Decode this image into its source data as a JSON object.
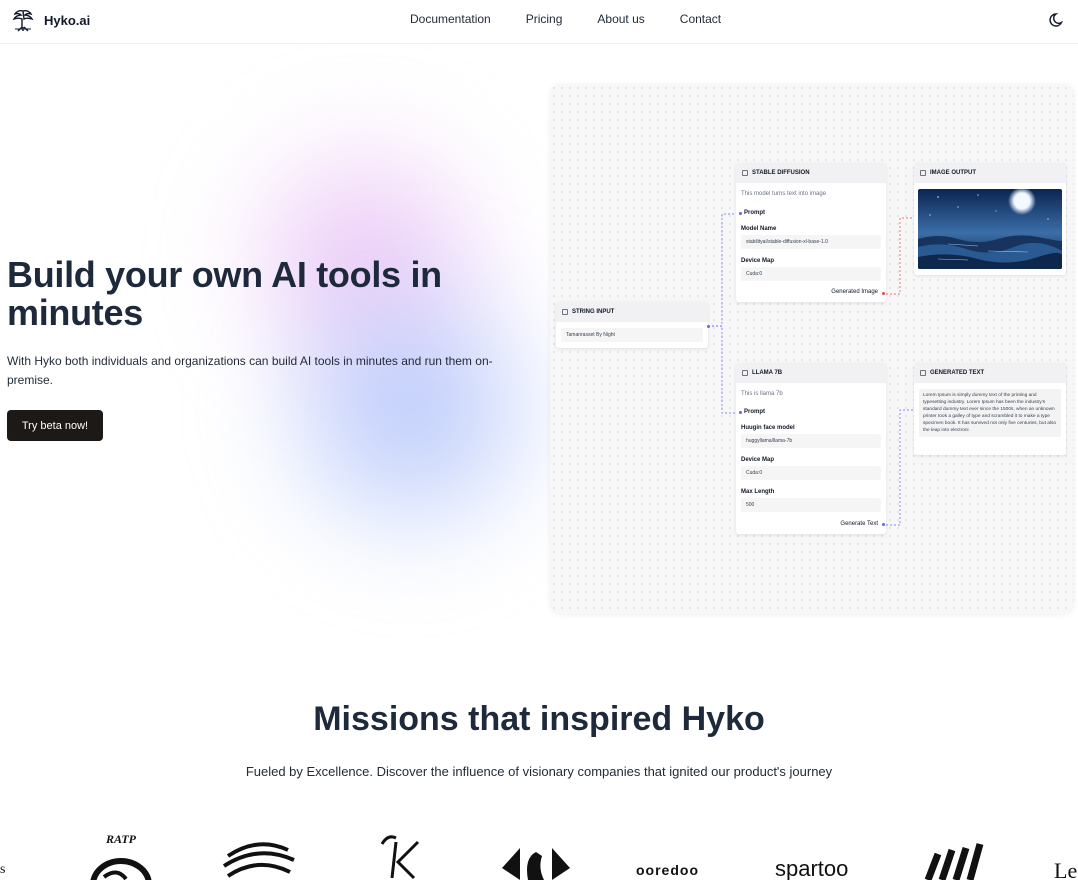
{
  "brand": {
    "name": "Hyko.ai"
  },
  "nav": {
    "links": [
      "Documentation",
      "Pricing",
      "About us",
      "Contact"
    ]
  },
  "hero": {
    "title": "Build your own AI tools in minutes",
    "subtitle": "With Hyko both individuals and organizations can build AI tools in minutes and run them on-premise.",
    "cta": "Try beta now!"
  },
  "canvas": {
    "string_input": {
      "title": "STRING INPUT",
      "value": "Tamanrasset By Night"
    },
    "stable_diffusion": {
      "title": "STABLE DIFFUSION",
      "desc": "This model turns text into image",
      "prompt": "Prompt",
      "model_label": "Model Name",
      "model_value": "stabilityai/stable-diffusion-xl-base-1.0",
      "device_label": "Device Map",
      "device_value": "Cuda:0",
      "output": "Generated Image"
    },
    "image_output": {
      "title": "IMAGE OUTPUT"
    },
    "llama": {
      "title": "LLAMA 7B",
      "desc": "This is llama 7b",
      "prompt": "Prompt",
      "model_label": "Huugin face model",
      "model_value": "huggyllama/llama-7b",
      "device_label": "Device Map",
      "device_value": "Cuda:0",
      "max_label": "Max Length",
      "max_value": "500",
      "output": "Generate Text"
    },
    "generated_text": {
      "title": "GENERATED TEXT",
      "text": "Lorem Ipsum is simply dummy text of the printing and typesetting industry. Lorem Ipsum has been the industry's standard dummy text ever since the 1500s, when an unknown printer took a galley of type and scrambled it to make a type specimen book. It has survived not only five centuries, but also the leap into electroni"
    }
  },
  "missions": {
    "title": "Missions that inspired Hyko",
    "subtitle": "Fueled by Excellence. Discover the influence of visionary companies that ignited our product's journey",
    "logos": {
      "ratp": "RATP",
      "ooredoo": "ooredoo",
      "spartoo": "spartoo",
      "left_cut": "s",
      "right_cut": "Le"
    }
  },
  "colors": {
    "cta_bg": "#1c1917",
    "title": "#1e293b",
    "edge_blue": "#6366f1",
    "edge_red": "#ef4444"
  }
}
